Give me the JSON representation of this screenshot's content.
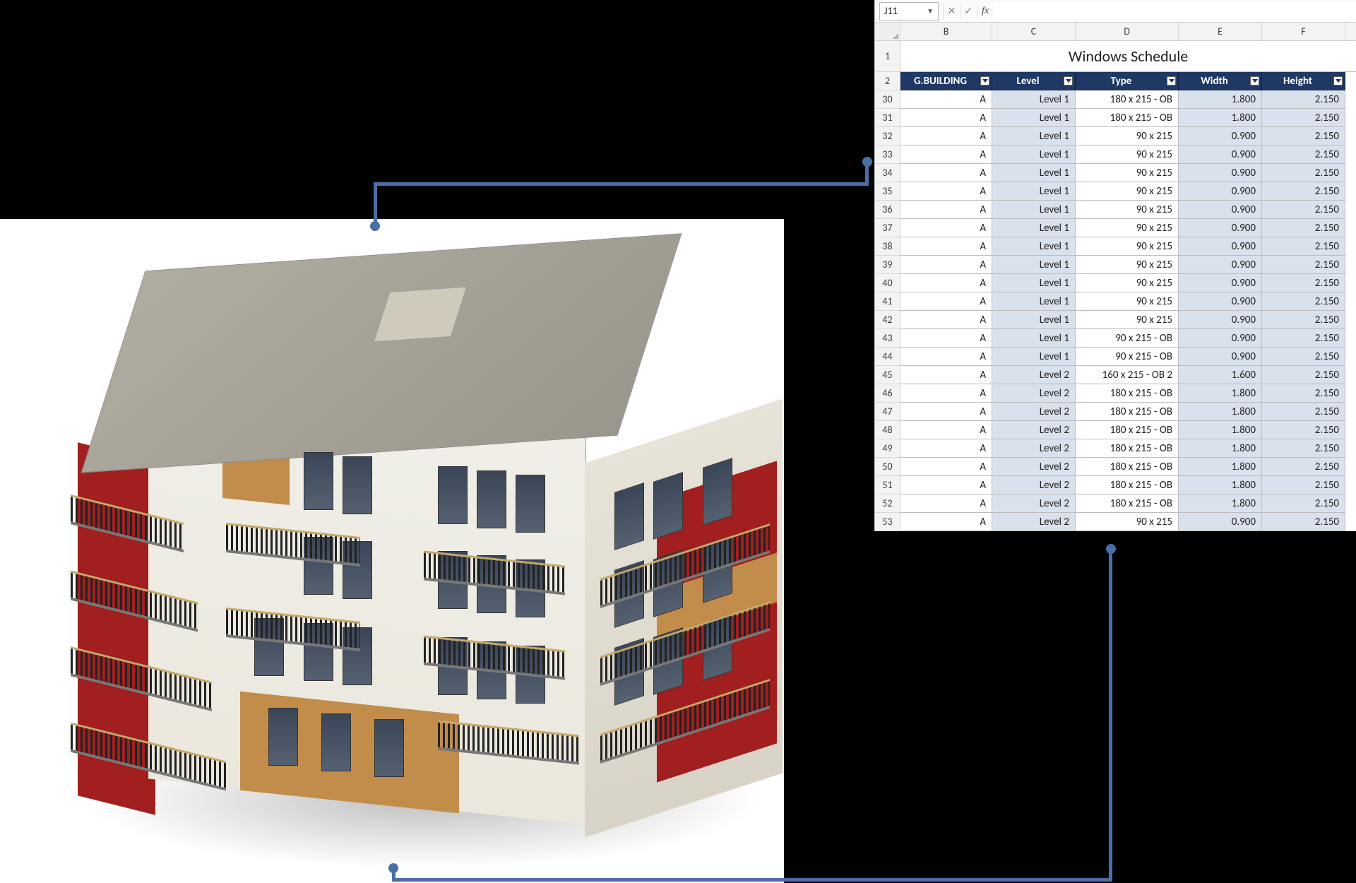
{
  "formula_bar": {
    "name_box": "J11",
    "fx_label": "fx"
  },
  "columns": [
    "B",
    "C",
    "D",
    "E",
    "F"
  ],
  "title": "Windows Schedule",
  "headers": [
    "G.BUILDING",
    "Level",
    "Type",
    "Width",
    "Height"
  ],
  "rows": [
    {
      "n": "30",
      "b": "A",
      "c": "Level 1",
      "d": "180 x 215 - OB",
      "e": "1.800",
      "f": "2.150"
    },
    {
      "n": "31",
      "b": "A",
      "c": "Level 1",
      "d": "180 x 215 - OB",
      "e": "1.800",
      "f": "2.150"
    },
    {
      "n": "32",
      "b": "A",
      "c": "Level 1",
      "d": "90 x 215",
      "e": "0.900",
      "f": "2.150"
    },
    {
      "n": "33",
      "b": "A",
      "c": "Level 1",
      "d": "90 x 215",
      "e": "0.900",
      "f": "2.150"
    },
    {
      "n": "34",
      "b": "A",
      "c": "Level 1",
      "d": "90 x 215",
      "e": "0.900",
      "f": "2.150"
    },
    {
      "n": "35",
      "b": "A",
      "c": "Level 1",
      "d": "90 x 215",
      "e": "0.900",
      "f": "2.150"
    },
    {
      "n": "36",
      "b": "A",
      "c": "Level 1",
      "d": "90 x 215",
      "e": "0.900",
      "f": "2.150"
    },
    {
      "n": "37",
      "b": "A",
      "c": "Level 1",
      "d": "90 x 215",
      "e": "0.900",
      "f": "2.150"
    },
    {
      "n": "38",
      "b": "A",
      "c": "Level 1",
      "d": "90 x 215",
      "e": "0.900",
      "f": "2.150"
    },
    {
      "n": "39",
      "b": "A",
      "c": "Level 1",
      "d": "90 x 215",
      "e": "0.900",
      "f": "2.150"
    },
    {
      "n": "40",
      "b": "A",
      "c": "Level 1",
      "d": "90 x 215",
      "e": "0.900",
      "f": "2.150"
    },
    {
      "n": "41",
      "b": "A",
      "c": "Level 1",
      "d": "90 x 215",
      "e": "0.900",
      "f": "2.150"
    },
    {
      "n": "42",
      "b": "A",
      "c": "Level 1",
      "d": "90 x 215",
      "e": "0.900",
      "f": "2.150"
    },
    {
      "n": "43",
      "b": "A",
      "c": "Level 1",
      "d": "90 x 215 - OB",
      "e": "0.900",
      "f": "2.150"
    },
    {
      "n": "44",
      "b": "A",
      "c": "Level 1",
      "d": "90 x 215 - OB",
      "e": "0.900",
      "f": "2.150"
    },
    {
      "n": "45",
      "b": "A",
      "c": "Level 2",
      "d": "160 x 215 - OB 2",
      "e": "1.600",
      "f": "2.150"
    },
    {
      "n": "46",
      "b": "A",
      "c": "Level 2",
      "d": "180 x 215 - OB",
      "e": "1.800",
      "f": "2.150"
    },
    {
      "n": "47",
      "b": "A",
      "c": "Level 2",
      "d": "180 x 215 - OB",
      "e": "1.800",
      "f": "2.150"
    },
    {
      "n": "48",
      "b": "A",
      "c": "Level 2",
      "d": "180 x 215 - OB",
      "e": "1.800",
      "f": "2.150"
    },
    {
      "n": "49",
      "b": "A",
      "c": "Level 2",
      "d": "180 x 215 - OB",
      "e": "1.800",
      "f": "2.150"
    },
    {
      "n": "50",
      "b": "A",
      "c": "Level 2",
      "d": "180 x 215 - OB",
      "e": "1.800",
      "f": "2.150"
    },
    {
      "n": "51",
      "b": "A",
      "c": "Level 2",
      "d": "180 x 215 - OB",
      "e": "1.800",
      "f": "2.150"
    },
    {
      "n": "52",
      "b": "A",
      "c": "Level 2",
      "d": "180 x 215 - OB",
      "e": "1.800",
      "f": "2.150"
    },
    {
      "n": "53",
      "b": "A",
      "c": "Level 2",
      "d": "90 x 215",
      "e": "0.900",
      "f": "2.150"
    }
  ],
  "row_header_title": "1",
  "row_header_filters": "2"
}
